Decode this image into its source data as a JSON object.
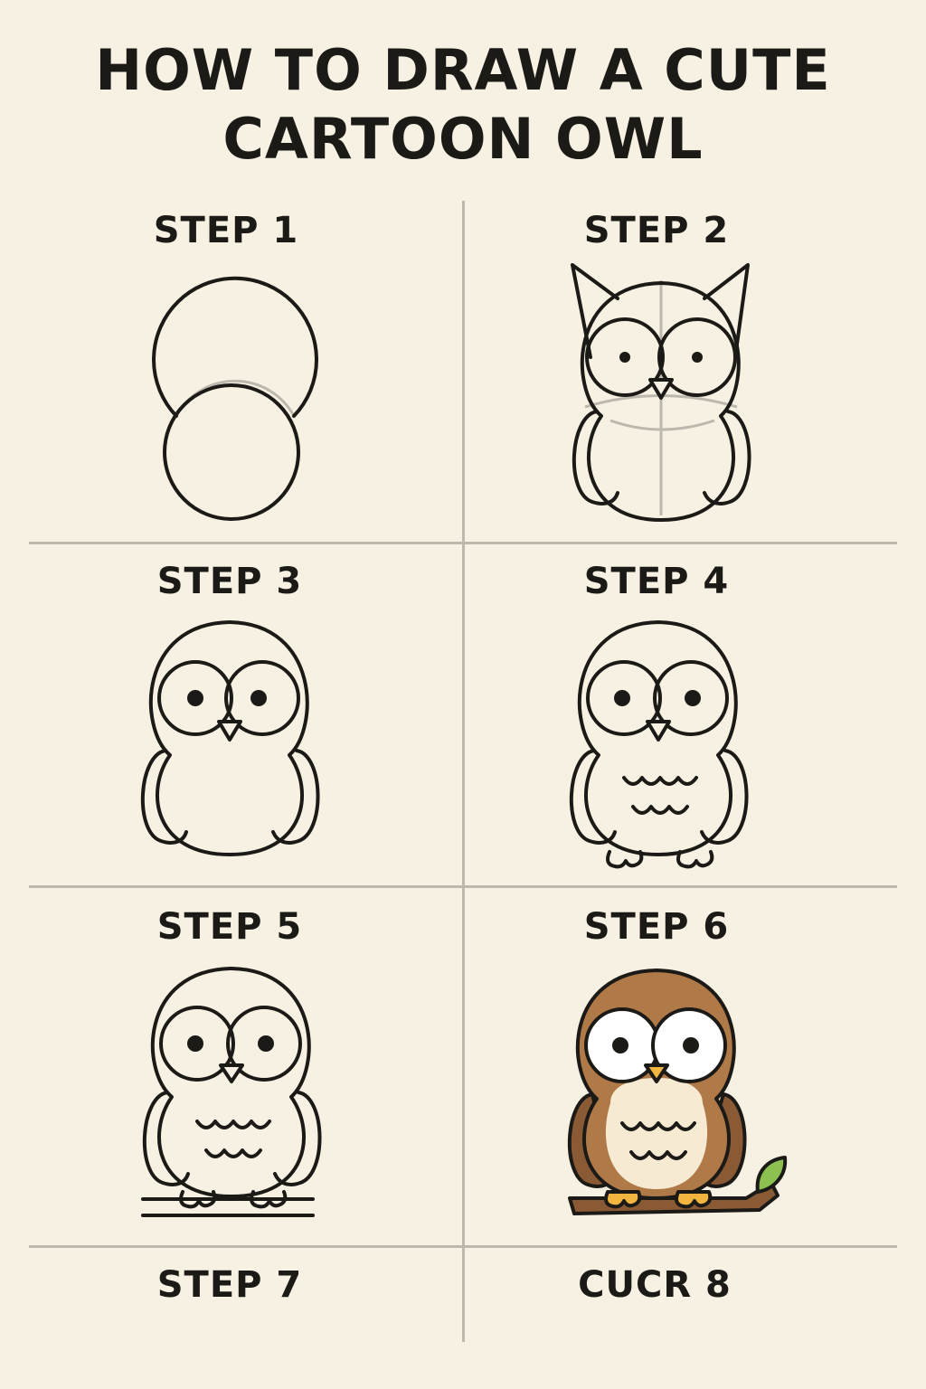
{
  "title": {
    "line1": "HOW TO DRAW A CUTE",
    "line2": "CARTOON OWL"
  },
  "steps": [
    {
      "label": "STEP 1"
    },
    {
      "label": "STEP 2"
    },
    {
      "label": "STEP 3"
    },
    {
      "label": "STEP 4"
    },
    {
      "label": "STEP 5"
    },
    {
      "label": "STEP 6"
    },
    {
      "label": "STEP 7"
    },
    {
      "label": "CUCR 8"
    }
  ],
  "colors": {
    "background": "#f6f1e3",
    "ink": "#1c1a17",
    "divider": "#bdb8ad",
    "owl_brown": "#b07a48",
    "owl_wing": "#8a5a34",
    "owl_belly": "#f6ead2",
    "beak_yellow": "#f2b640",
    "branch": "#8a5a34",
    "leaf": "#8cc152"
  }
}
